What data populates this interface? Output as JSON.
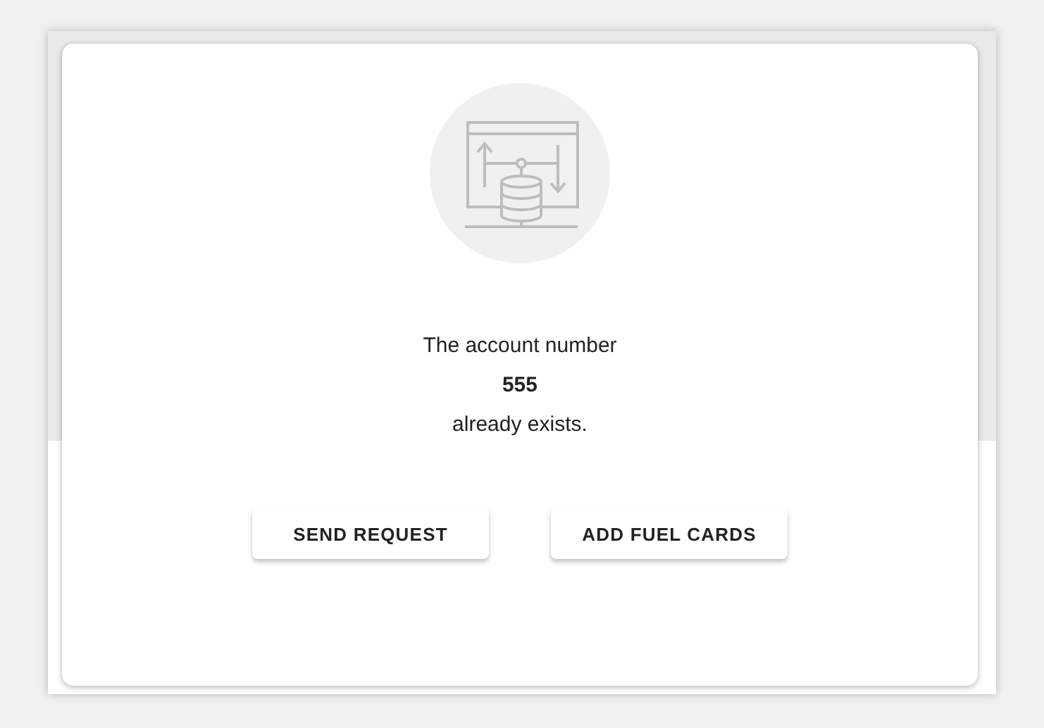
{
  "message": {
    "lines": [
      {
        "text": "The account number",
        "bold": false
      },
      {
        "text": "555",
        "bold": true
      },
      {
        "text": "already exists.",
        "bold": false
      }
    ]
  },
  "buttons": [
    "SEND REQUEST",
    "ADD FUEL CARDS"
  ]
}
